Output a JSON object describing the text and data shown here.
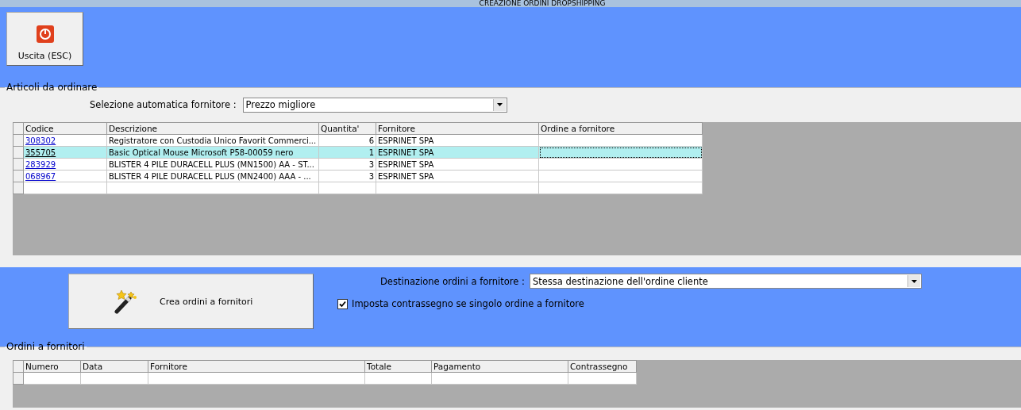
{
  "window": {
    "title": "CREAZIONE ORDINI DROPSHIPPING"
  },
  "toolbar": {
    "exit_button": "Uscita (ESC)"
  },
  "articles": {
    "title": "Articoli da ordinare",
    "auto_supplier": {
      "label": "Selezione automatica fornitore :",
      "value": "Prezzo migliore"
    },
    "columns": [
      "Codice",
      "Descrizione",
      "Quantita'",
      "Fornitore",
      "Ordine a fornitore"
    ],
    "rows": [
      {
        "code": "308302",
        "description": "Registratore con Custodia Unico Favorit Commerci...",
        "quantity": "6",
        "supplier": "ESPRINET SPA",
        "selected": false
      },
      {
        "code": "355705",
        "description": "Basic Optical Mouse Microsoft P58-00059 nero",
        "quantity": "1",
        "supplier": "ESPRINET SPA",
        "selected": true
      },
      {
        "code": "283929",
        "description": "BLISTER 4 PILE DURACELL PLUS (MN1500) AA - ST...",
        "quantity": "3",
        "supplier": "ESPRINET SPA",
        "selected": false
      },
      {
        "code": "068967",
        "description": "BLISTER 4 PILE DURACELL PLUS (MN2400) AAA - ...",
        "quantity": "3",
        "supplier": "ESPRINET SPA",
        "selected": false
      }
    ]
  },
  "actions": {
    "create_button": "Crea ordini a fornitori",
    "destination": {
      "label": "Destinazione ordini a fornitore :",
      "value": "Stessa destinazione dell'ordine cliente"
    },
    "cod_checkbox": {
      "label": "Imposta contrassegno se singolo ordine a fornitore",
      "checked": true
    }
  },
  "orders": {
    "title": "Ordini a fornitori",
    "columns": [
      "Numero",
      "Data",
      "Fornitore",
      "Totale",
      "Pagamento",
      "Contrassegno"
    ]
  }
}
